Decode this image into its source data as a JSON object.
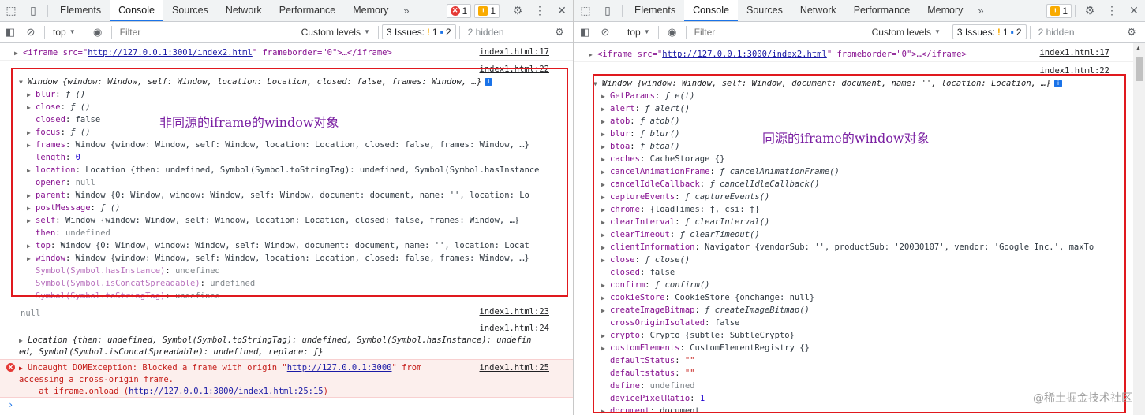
{
  "left": {
    "tabs": [
      "Elements",
      "Console",
      "Sources",
      "Network",
      "Performance",
      "Memory"
    ],
    "active_tab": "Console",
    "more": "»",
    "error_count": "1",
    "warning_count": "1",
    "context": "top",
    "filter_placeholder": "Filter",
    "levels": "Custom levels",
    "issues_label": "3 Issues:",
    "issues_warn": "1",
    "issues_info": "2",
    "hidden": "2 hidden",
    "iframe_line": {
      "prefix": "<iframe src=\"",
      "url": "http://127.0.0.1:3001/index2.html",
      "suffix": "\" frameborder=\"0\">…</iframe>",
      "source": "index1.html:17"
    },
    "window_source": "index1.html:22",
    "window_head": "Window {window: Window, self: Window, location: Location, closed: false, frames: Window, …}",
    "props": [
      {
        "tri": "▶",
        "key": "blur",
        "val": "ƒ ()"
      },
      {
        "tri": "▶",
        "key": "close",
        "val": "ƒ ()"
      },
      {
        "tri": "",
        "key": "closed",
        "val": "false"
      },
      {
        "tri": "▶",
        "key": "focus",
        "val": "ƒ ()"
      },
      {
        "tri": "▶",
        "key": "frames",
        "val": "Window {window: Window, self: Window, location: Location, closed: false, frames: Window, …}"
      },
      {
        "tri": "",
        "key": "length",
        "val": "0"
      },
      {
        "tri": "▶",
        "key": "location",
        "val": "Location {then: undefined, Symbol(Symbol.toStringTag): undefined, Symbol(Symbol.hasInstance"
      },
      {
        "tri": "",
        "key": "opener",
        "val": "null"
      },
      {
        "tri": "▶",
        "key": "parent",
        "val": "Window {0: Window, window: Window, self: Window, document: document, name: '', location: Lo"
      },
      {
        "tri": "▶",
        "key": "postMessage",
        "val": "ƒ ()"
      },
      {
        "tri": "▶",
        "key": "self",
        "val": "Window {window: Window, self: Window, location: Location, closed: false, frames: Window, …}"
      },
      {
        "tri": "",
        "key": "then",
        "val": "undefined"
      },
      {
        "tri": "▶",
        "key": "top",
        "val": "Window {0: Window, window: Window, self: Window, document: document, name: '', location: Locat"
      },
      {
        "tri": "▶",
        "key": "window",
        "val": "Window {window: Window, self: Window, location: Location, closed: false, frames: Window, …}"
      },
      {
        "tri": "",
        "key": "Symbol(Symbol.hasInstance)",
        "val": "undefined"
      },
      {
        "tri": "",
        "key": "Symbol(Symbol.isConcatSpreadable)",
        "val": "undefined"
      },
      {
        "tri": "",
        "key": "Symbol(Symbol.toStringTag)",
        "val": "undefined"
      }
    ],
    "annotation": "非同源的iframe的window对象",
    "null_line": {
      "text": "null",
      "source": "index1.html:23"
    },
    "location_source": "index1.html:24",
    "location_line1": "Location {then: undefined, Symbol(Symbol.toStringTag): undefined, Symbol(Symbol.hasInstance): undefin",
    "location_line2": "ed, Symbol(Symbol.isConcatSpreadable): undefined, replace: ƒ}",
    "error": {
      "source": "index1.html:25",
      "line1_prefix": "Uncaught DOMException: Blocked a frame with origin \"",
      "line1_url": "http://127.0.0.1:3000",
      "line1_suffix": "\" from",
      "line2": "accessing a cross-origin frame.",
      "line3_prefix": "    at iframe.onload (",
      "line3_url": "http://127.0.0.1:3000/index1.html:25:15",
      "line3_suffix": ")"
    },
    "prompt": "›"
  },
  "right": {
    "tabs": [
      "Elements",
      "Console",
      "Sources",
      "Network",
      "Performance",
      "Memory"
    ],
    "active_tab": "Console",
    "more": "»",
    "warning_count": "1",
    "context": "top",
    "filter_placeholder": "Filter",
    "levels": "Custom levels",
    "issues_label": "3 Issues:",
    "issues_warn": "1",
    "issues_info": "2",
    "hidden": "2 hidden",
    "iframe_line": {
      "prefix": "<iframe src=\"",
      "url": "http://127.0.0.1:3000/index2.html",
      "suffix": "\" frameborder=\"0\">…</iframe>",
      "source": "index1.html:17"
    },
    "window_source": "index1.html:22",
    "window_head": "Window {window: Window, self: Window, document: document, name: '', location: Location, …}",
    "props": [
      {
        "tri": "▶",
        "key": "GetParams",
        "val": "ƒ e(t)"
      },
      {
        "tri": "▶",
        "key": "alert",
        "val": "ƒ alert()"
      },
      {
        "tri": "▶",
        "key": "atob",
        "val": "ƒ atob()"
      },
      {
        "tri": "▶",
        "key": "blur",
        "val": "ƒ blur()"
      },
      {
        "tri": "▶",
        "key": "btoa",
        "val": "ƒ btoa()"
      },
      {
        "tri": "▶",
        "key": "caches",
        "val": "CacheStorage {}"
      },
      {
        "tri": "▶",
        "key": "cancelAnimationFrame",
        "val": "ƒ cancelAnimationFrame()"
      },
      {
        "tri": "▶",
        "key": "cancelIdleCallback",
        "val": "ƒ cancelIdleCallback()"
      },
      {
        "tri": "▶",
        "key": "captureEvents",
        "val": "ƒ captureEvents()"
      },
      {
        "tri": "▶",
        "key": "chrome",
        "val": "{loadTimes: ƒ, csi: ƒ}"
      },
      {
        "tri": "▶",
        "key": "clearInterval",
        "val": "ƒ clearInterval()"
      },
      {
        "tri": "▶",
        "key": "clearTimeout",
        "val": "ƒ clearTimeout()"
      },
      {
        "tri": "▶",
        "key": "clientInformation",
        "val": "Navigator {vendorSub: '', productSub: '20030107', vendor: 'Google Inc.', maxTo"
      },
      {
        "tri": "▶",
        "key": "close",
        "val": "ƒ close()"
      },
      {
        "tri": "",
        "key": "closed",
        "val": "false"
      },
      {
        "tri": "▶",
        "key": "confirm",
        "val": "ƒ confirm()"
      },
      {
        "tri": "▶",
        "key": "cookieStore",
        "val": "CookieStore {onchange: null}"
      },
      {
        "tri": "▶",
        "key": "createImageBitmap",
        "val": "ƒ createImageBitmap()"
      },
      {
        "tri": "",
        "key": "crossOriginIsolated",
        "val": "false"
      },
      {
        "tri": "▶",
        "key": "crypto",
        "val": "Crypto {subtle: SubtleCrypto}"
      },
      {
        "tri": "▶",
        "key": "customElements",
        "val": "CustomElementRegistry {}"
      },
      {
        "tri": "",
        "key": "defaultStatus",
        "val": "\"\""
      },
      {
        "tri": "",
        "key": "defaultstatus",
        "val": "\"\""
      },
      {
        "tri": "",
        "key": "define",
        "val": "undefined"
      },
      {
        "tri": "",
        "key": "devicePixelRatio",
        "val": "1"
      },
      {
        "tri": "▶",
        "key": "document",
        "val": "document"
      }
    ],
    "annotation": "同源的iframe的window对象",
    "watermark": "@稀土掘金技术社区"
  }
}
